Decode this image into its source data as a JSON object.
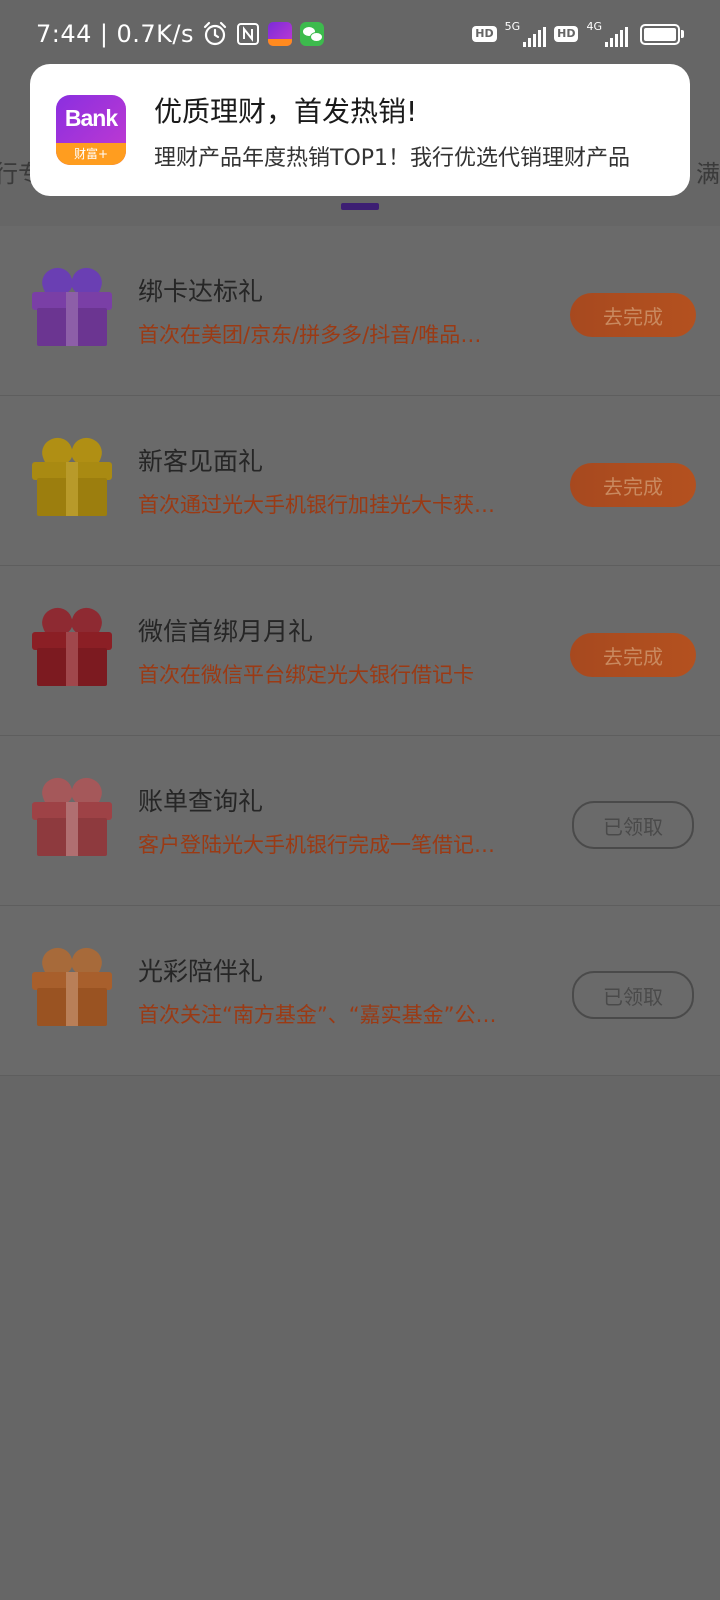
{
  "status_bar": {
    "time": "7:44",
    "separator": "|",
    "net_speed": "0.7K/s",
    "sim1_hd": "HD",
    "sim1_type": "5G",
    "sim2_hd": "HD",
    "sim2_type": "4G",
    "icons": [
      "alarm-icon",
      "nfc-icon",
      "bank-app-icon",
      "wechat-icon",
      "battery-icon"
    ]
  },
  "tabs": {
    "left_partial": "行专",
    "right_partial": "满"
  },
  "notification": {
    "app_icon_label": "Bank",
    "app_icon_sub": "财富+",
    "title": "优质理财，首发热销!",
    "body": "理财产品年度热销TOP1！我行优选代销理财产品"
  },
  "tasks": [
    {
      "title": "绑卡达标礼",
      "desc": "首次在美团/京东/拼多多/抖音/唯品会绑卡",
      "button": "去完成",
      "status": "todo",
      "gift_color": "purple"
    },
    {
      "title": "新客见面礼",
      "desc": "首次通过光大手机银行加挂光大卡获赠好礼",
      "button": "去完成",
      "status": "todo",
      "gift_color": "gold"
    },
    {
      "title": "微信首绑月月礼",
      "desc": "首次在微信平台绑定光大银行借记卡",
      "button": "去完成",
      "status": "todo",
      "gift_color": "red"
    },
    {
      "title": "账单查询礼",
      "desc": "客户登陆光大手机银行完成一笔借记卡账单查询",
      "button": "已领取",
      "status": "claimed",
      "gift_color": "pink-red"
    },
    {
      "title": "光彩陪伴礼",
      "desc": "首次关注“南方基金”、“嘉实基金”公众号",
      "button": "已领取",
      "status": "claimed",
      "gift_color": "orange"
    }
  ],
  "colors": {
    "overlay_bg": "#666666",
    "todo_button": "#b04d1f",
    "desc_text": "#9b3a14",
    "tab_indicator": "#3d1f73"
  }
}
